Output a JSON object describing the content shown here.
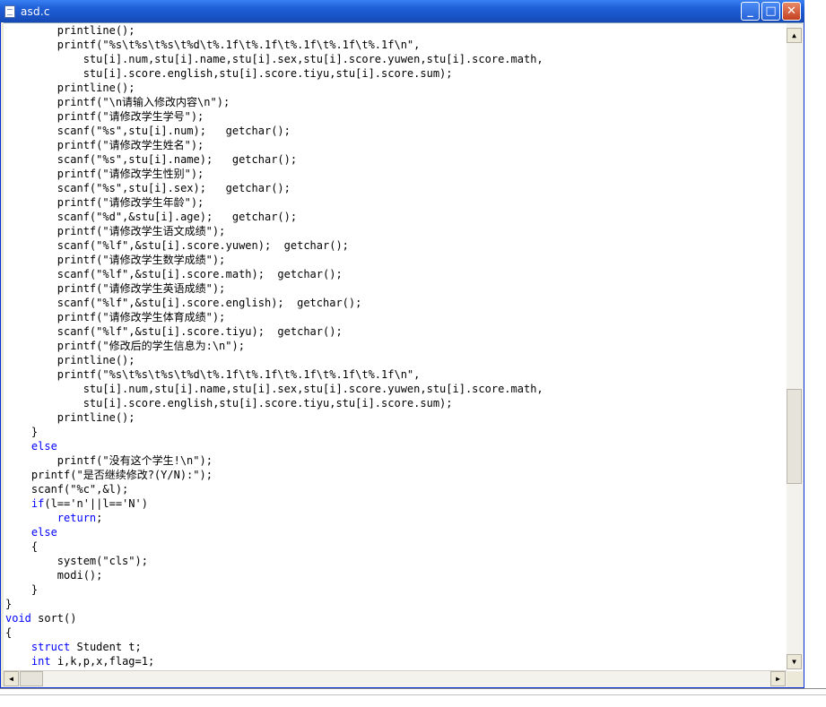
{
  "window": {
    "title": "asd.c",
    "minimize_label": "_",
    "maximize_label": "□",
    "close_label": "✕"
  },
  "scrollbar": {
    "up_arrow": "▲",
    "down_arrow": "▼",
    "left_arrow": "◀",
    "right_arrow": "▶"
  },
  "code_lines": [
    "        printline();",
    "        printf(\"%s\\t%s\\t%s\\t%d\\t%.1f\\t%.1f\\t%.1f\\t%.1f\\t%.1f\\n\",",
    "            stu[i].num,stu[i].name,stu[i].sex,stu[i].score.yuwen,stu[i].score.math,",
    "            stu[i].score.english,stu[i].score.tiyu,stu[i].score.sum);",
    "        printline();",
    "        printf(\"\\n请输入修改内容\\n\");",
    "        printf(\"请修改学生学号\");",
    "        scanf(\"%s\",stu[i].num);   getchar();",
    "        printf(\"请修改学生姓名\");",
    "        scanf(\"%s\",stu[i].name);   getchar();",
    "        printf(\"请修改学生性别\");",
    "        scanf(\"%s\",stu[i].sex);   getchar();",
    "        printf(\"请修改学生年龄\");",
    "        scanf(\"%d\",&stu[i].age);   getchar();",
    "        printf(\"请修改学生语文成绩\");",
    "        scanf(\"%lf\",&stu[i].score.yuwen);  getchar();",
    "        printf(\"请修改学生数学成绩\");",
    "        scanf(\"%lf\",&stu[i].score.math);  getchar();",
    "        printf(\"请修改学生英语成绩\");",
    "        scanf(\"%lf\",&stu[i].score.english);  getchar();",
    "        printf(\"请修改学生体育成绩\");",
    "        scanf(\"%lf\",&stu[i].score.tiyu);  getchar();",
    "        printf(\"修改后的学生信息为:\\n\");",
    "        printline();",
    "        printf(\"%s\\t%s\\t%s\\t%d\\t%.1f\\t%.1f\\t%.1f\\t%.1f\\t%.1f\\n\",",
    "            stu[i].num,stu[i].name,stu[i].sex,stu[i].score.yuwen,stu[i].score.math,",
    "            stu[i].score.english,stu[i].score.tiyu,stu[i].score.sum);",
    "        printline();",
    "    }",
    "    else",
    "        printf(\"没有这个学生!\\n\");",
    "    printf(\"是否继续修改?(Y/N):\");",
    "    scanf(\"%c\",&l);",
    "    if(l=='n'||l=='N')",
    "        return;",
    "    else",
    "    {",
    "        system(\"cls\");",
    "        modi();",
    "    }",
    "}",
    "void sort()",
    "{",
    "    struct Student t;",
    "    int i,k,p,x,flag=1;"
  ],
  "keywords": [
    "else",
    "if",
    "return",
    "void",
    "struct",
    "int"
  ],
  "colors": {
    "keyword": "#0000ff",
    "text": "#000000",
    "titlebar": "#1f5fd7"
  }
}
